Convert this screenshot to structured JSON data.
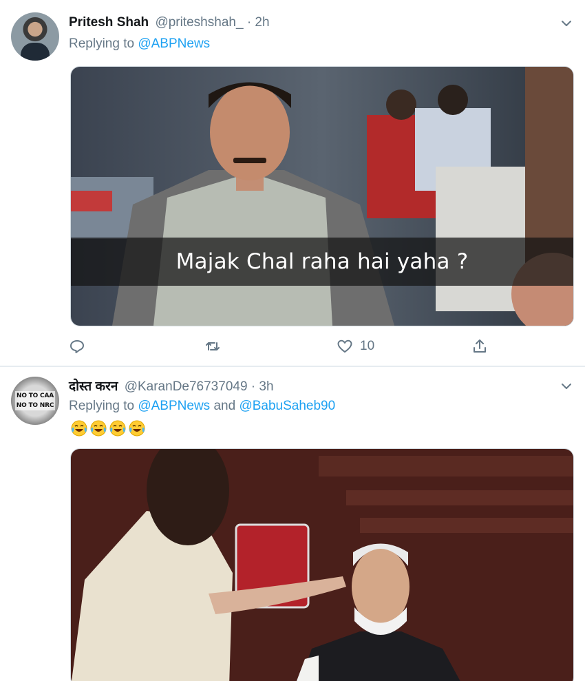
{
  "tweets": [
    {
      "author_name": "Pritesh Shah",
      "handle": "@priteshshah_",
      "separator": "·",
      "time": "2h",
      "replying_prefix": "Replying to",
      "mentions": [
        "@ABPNews"
      ],
      "media_caption": "Majak Chal raha hai yaha ?",
      "actions": {
        "reply_count": "",
        "retweet_count": "",
        "like_count": "10"
      }
    },
    {
      "author_name": "दोस्त करन",
      "handle": "@KaranDe76737049",
      "separator": "·",
      "time": "3h",
      "replying_prefix": "Replying to",
      "mentions": [
        "@ABPNews",
        "@BabuSaheb90"
      ],
      "mention_joiner": "and",
      "avatar_text": [
        "NO TO CAA",
        "NO TO NRC"
      ],
      "emoji_count": 4
    }
  ],
  "colors": {
    "link": "#1da1f2",
    "secondary_text": "#657786",
    "primary_text": "#14171a",
    "divider": "#e6ecf0"
  },
  "icons": {
    "menu": "chevron-down-icon",
    "reply": "reply-icon",
    "retweet": "retweet-icon",
    "like": "heart-icon",
    "share": "share-icon",
    "emoji": "face-with-tears-of-joy-icon"
  }
}
